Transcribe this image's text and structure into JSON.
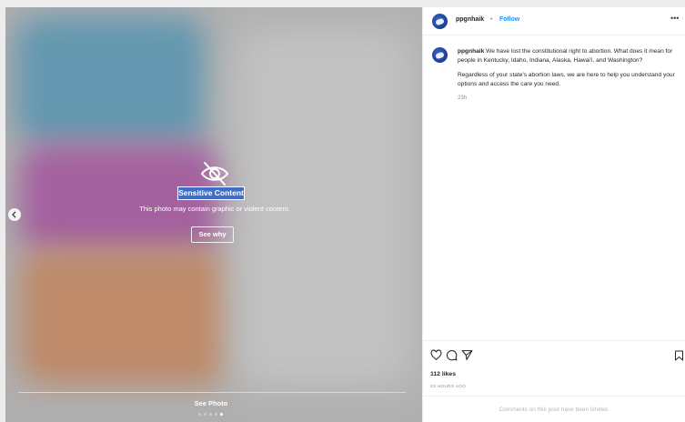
{
  "media": {
    "sensitive_title": "Sensitive Content",
    "sensitive_description": "This photo may contain graphic or violent content.",
    "see_why_label": "See why",
    "see_photo_label": "See Photo",
    "carousel_dots": 5,
    "carousel_active_index": 4
  },
  "post": {
    "username": "ppgnhaik",
    "separator": "•",
    "follow_label": "Follow",
    "caption_paragraph_1": "We have lost the constitutional right to abortion. What does it mean for people in Kentucky, Idaho, Indiana, Alaska, Hawai'i, and Washington?",
    "caption_paragraph_2": "Regardless of your state's abortion laws, we are here to help you understand your options and access the care you need.",
    "caption_time": "23h",
    "likes": "112 likes",
    "timestamp": "23 HOURS AGO",
    "comments_limited": "Comments on this post have been limited."
  },
  "colors": {
    "follow_link": "#2a8ff0",
    "sensitive_highlight": "#3d6fc9",
    "avatar": "#1c3c8f"
  },
  "icons": [
    "eye-slash-icon",
    "chevron-left-icon",
    "more-icon",
    "heart-icon",
    "comment-icon",
    "share-icon",
    "bookmark-icon"
  ]
}
